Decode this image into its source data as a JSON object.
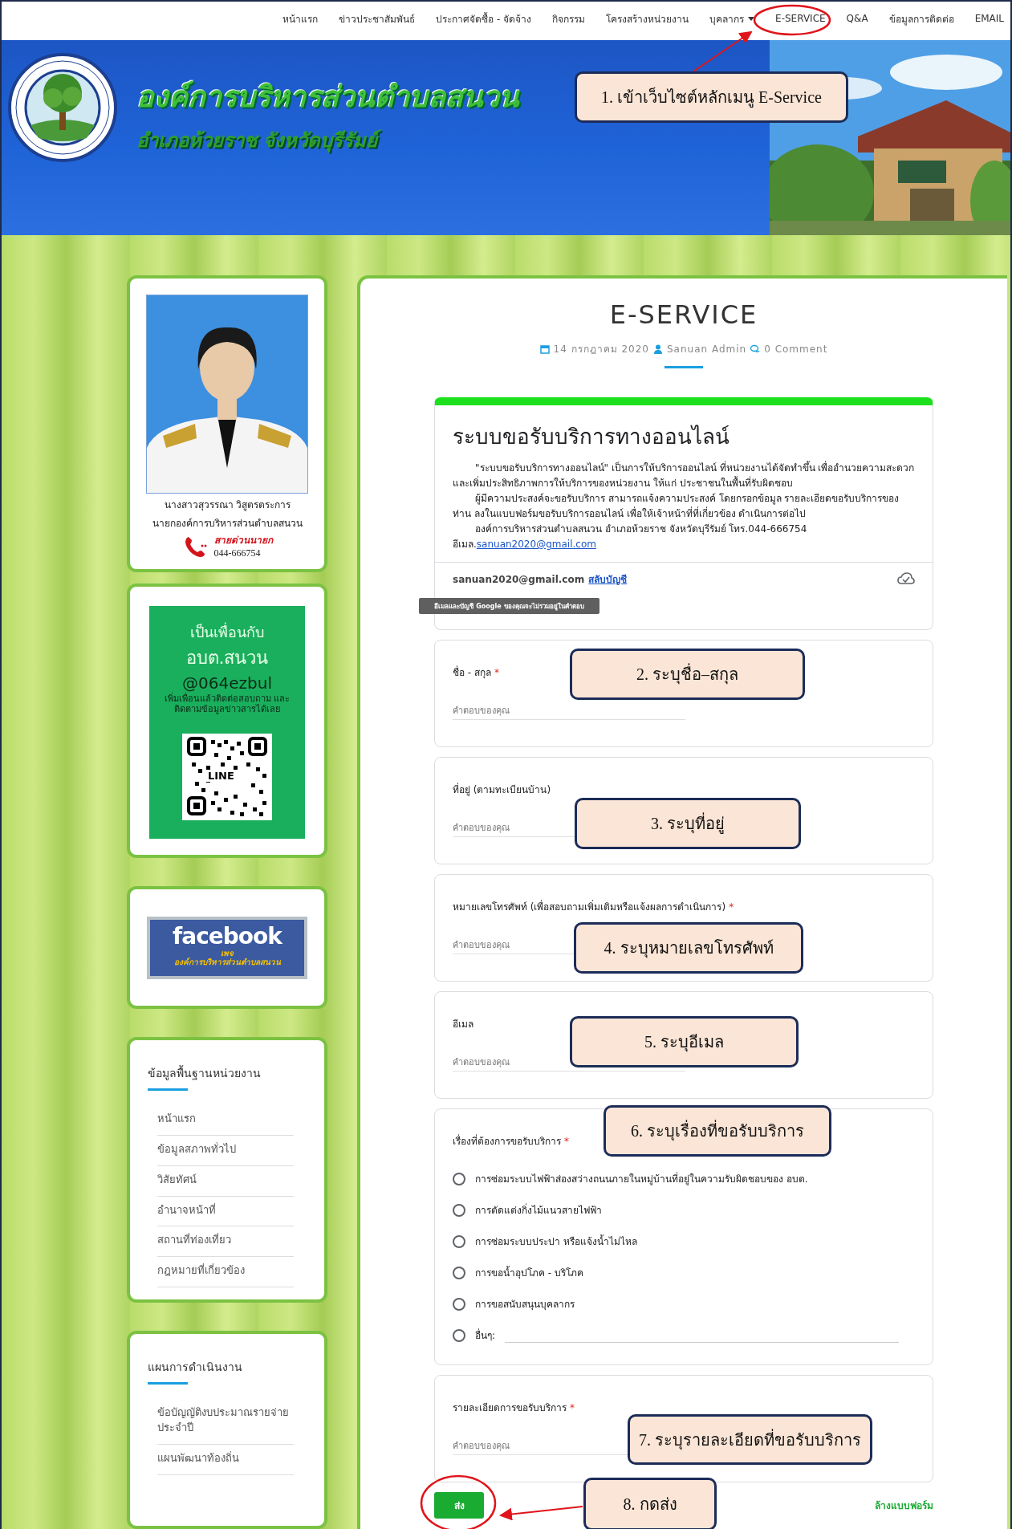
{
  "nav": [
    {
      "label": "หน้าแรก",
      "dropdown": false
    },
    {
      "label": "ข่าวประชาสัมพันธ์",
      "dropdown": false
    },
    {
      "label": "ประกาศจัดซื้อ - จัดจ้าง",
      "dropdown": false
    },
    {
      "label": "กิจกรรม",
      "dropdown": false
    },
    {
      "label": "โครงสร้างหน่วยงาน",
      "dropdown": false
    },
    {
      "label": "บุคลากร",
      "dropdown": true
    },
    {
      "label": "E-SERVICE",
      "dropdown": false
    },
    {
      "label": "Q&A",
      "dropdown": false
    },
    {
      "label": "ข้อมูลการติดต่อ",
      "dropdown": false
    },
    {
      "label": "EMAIL",
      "dropdown": false
    }
  ],
  "header": {
    "title": "องค์การบริหารส่วนตำบลสนวน",
    "subtitle": "อำเภอห้วยราช จังหวัดบุรีรัมย์"
  },
  "profile": {
    "name": "นางสาวสุวรรณา  วิสูตรตระการ",
    "position": "นายกองค์การบริหารส่วนตำบลสนวน",
    "hotline_label": "สายด่วนนายก",
    "phone": "044-666754"
  },
  "line_card": {
    "line1": "เป็นเพื่อนกับ",
    "line2": "อบต.สนวน",
    "line_id": "@064ezbul",
    "note": "เพิ่มเพื่อนแล้วติดต่อสอบถาม และติดตามข้อมูลข่าวสารได้เลย",
    "qr_label": "LINE"
  },
  "facebook": {
    "brand": "facebook",
    "page_label": "เพจ",
    "page_name": "องค์การบริหารส่วนตำบลสนวน"
  },
  "sidebar_sections": [
    {
      "title": "ข้อมูลพื้นฐานหน่วยงาน",
      "items": [
        "หน้าแรก",
        "ข้อมูลสภาพทั่วไป",
        "วิสัยทัศน์",
        "อำนาจหน้าที่",
        "สถานที่ท่องเที่ยว",
        "กฎหมายที่เกี่ยวข้อง"
      ]
    },
    {
      "title": "แผนการดำเนินงาน",
      "items": [
        "ข้อบัญญัติงบประมาณรายจ่ายประจำปี",
        "แผนพัฒนาท้องถิ่น"
      ]
    }
  ],
  "post": {
    "title": "E-SERVICE",
    "date": "14 กรกฎาคม 2020",
    "author": "Sanuan Admin",
    "comments": "0 Comment"
  },
  "form": {
    "title": "ระบบขอรับบริการทางออนไลน์",
    "description": [
      "\"ระบบขอรับบริการทางออนไลน์\" เป็นการให้บริการออนไลน์ ที่หน่วยงานได้จัดทำขึ้น เพื่ออำนวยความสะดวก และเพิ่มประสิทธิภาพการให้บริการของหน่วยงาน ให้แก่ ประชาชนในพื้นที่รับผิดชอบ",
      "ผู้มีความประสงค์จะขอรับบริการ สามารถแจ้งความประสงค์ โดยกรอกข้อมูล รายละเอียดขอรับบริการของท่าน ลงในแบบฟอร์มขอรับบริการออนไลน์ เพื่อให้เจ้าหน้าที่ที่เกี่ยวข้อง ดำเนินการต่อไป",
      "องค์การบริหารส่วนตำบลสนวน  อำเภอห้วยราช จังหวัดบุรีรัมย์  โทร.044-666754"
    ],
    "email_prefix": "อีเมล.",
    "email_link": "sanuan2020@gmail.com",
    "account": "sanuan2020@gmail.com",
    "switch_account": "สลับบัญชี",
    "tooltip": "อีเมลและบัญชี Google ของคุณจะไม่รวมอยู่ในคำตอบ",
    "questions": [
      {
        "kind": "text",
        "label": "ชื่อ - สกุล",
        "required_mark": "*",
        "placeholder": "คำตอบของคุณ"
      },
      {
        "kind": "text",
        "label": "ที่อยู่ (ตามทะเบียนบ้าน)",
        "placeholder": "คำตอบของคุณ"
      },
      {
        "kind": "text",
        "label": "หมายเลขโทรศัพท์ (เพื่อสอบถามเพิ่มเติมหรือแจ้งผลการดำเนินการ)",
        "required_mark": "*",
        "placeholder": "คำตอบของคุณ"
      },
      {
        "kind": "text",
        "label": "อีเมล",
        "placeholder": "คำตอบของคุณ"
      },
      {
        "kind": "radio",
        "label": "เรื่องที่ต้องการขอรับบริการ",
        "required_mark": "*",
        "options": [
          {
            "kind": "option",
            "label": "การซ่อมระบบไฟฟ้าส่องสว่างถนนภายในหมู่บ้านที่อยู่ในความรับผิดชอบของ อบต.",
            "selected": false
          },
          {
            "kind": "option",
            "label": "การตัดแต่งกิ่งไม้แนวสายไฟฟ้า",
            "selected": false
          },
          {
            "kind": "option",
            "label": "การซ่อมระบบประปา หรือแจ้งน้ำไม่ไหล",
            "selected": false
          },
          {
            "kind": "option",
            "label": "การขอน้ำอุปโภค - บริโภค",
            "selected": false
          },
          {
            "kind": "option",
            "label": "การขอสนับสนุนบุคลากร",
            "selected": false
          },
          {
            "kind": "other",
            "label": "อื่นๆ:",
            "selected": false
          }
        ]
      },
      {
        "kind": "text",
        "label": "รายละเอียดการขอรับบริการ",
        "required_mark": "*",
        "placeholder": "คำตอบของคุณ"
      }
    ],
    "submit": "ส่ง",
    "clear": "ล้างแบบฟอร์ม"
  },
  "annotations": [
    {
      "text": "1. เข้าเว็บไซต์หลักเมนู E-Service"
    },
    {
      "text": "2. ระบุชื่อ–สกุล"
    },
    {
      "text": "3. ระบุที่อยู่"
    },
    {
      "text": "4. ระบุหมายเลขโทรศัพท์"
    },
    {
      "text": "5. ระบุอีเมล"
    },
    {
      "text": "6. ระบุเรื่องที่ขอรับบริการ"
    },
    {
      "text": "7. ระบุรายละเอียดที่ขอรับบริการ"
    },
    {
      "text": "8. กดส่ง"
    }
  ]
}
